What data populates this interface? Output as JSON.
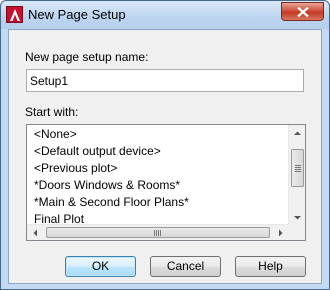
{
  "window": {
    "title": "New Page Setup"
  },
  "form": {
    "name_label": "New page setup name:",
    "name_value": "Setup1",
    "start_with_label": "Start with:",
    "start_with_items": [
      "<None>",
      "<Default output device>",
      "<Previous plot>",
      "*Doors Windows & Rooms*",
      "*Main & Second Floor Plans*",
      "Final Plot"
    ]
  },
  "buttons": {
    "ok": "OK",
    "cancel": "Cancel",
    "help": "Help"
  },
  "colors": {
    "title_bar": "#bcd4ef",
    "close_button": "#c23a22",
    "app_icon": "#c8102e"
  }
}
